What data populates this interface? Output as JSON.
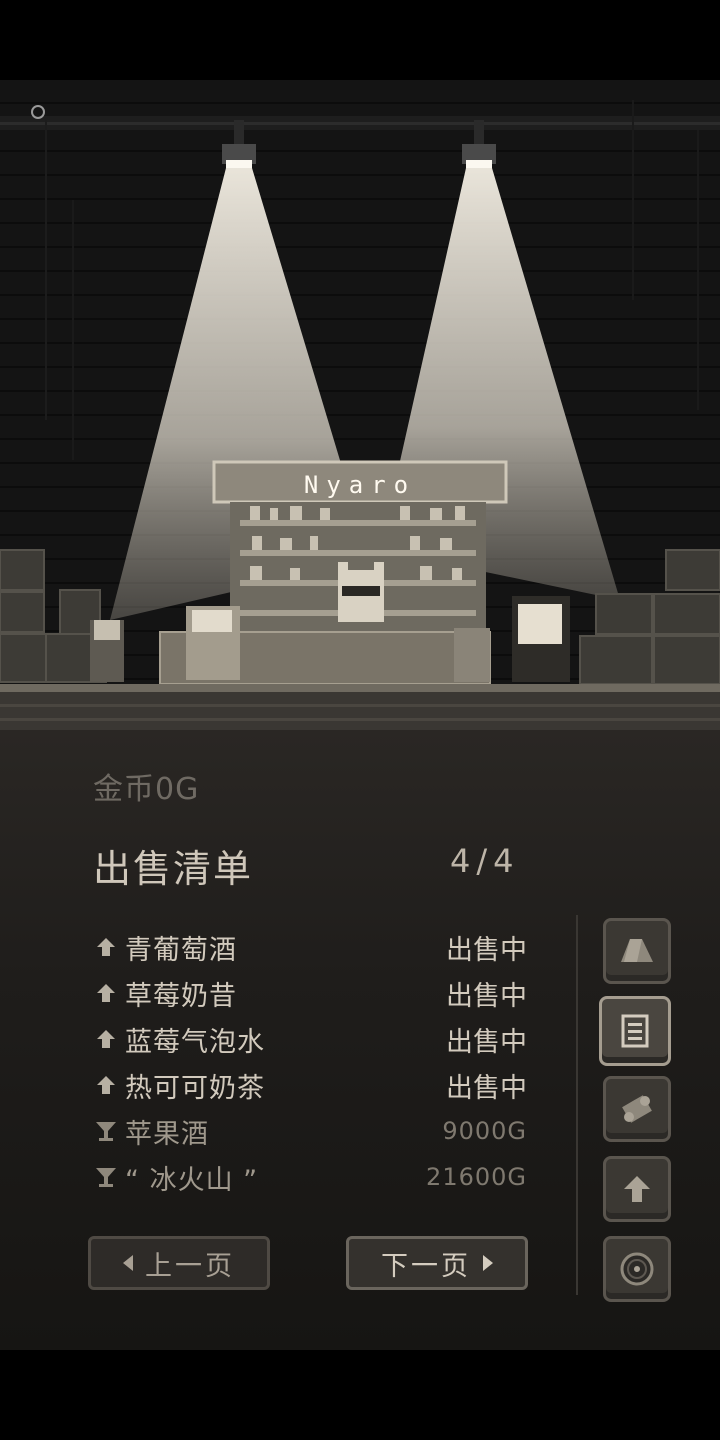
{
  "scene": {
    "shop_sign": "Nyaro"
  },
  "panel": {
    "gold_label": "金币",
    "gold_value": "0G",
    "list_title": "出售清单",
    "page": "4/4",
    "items": [
      {
        "icon": "arrow-up-icon",
        "name": "青葡萄酒",
        "status": "出售中"
      },
      {
        "icon": "arrow-up-icon",
        "name": "草莓奶昔",
        "status": "出售中"
      },
      {
        "icon": "arrow-up-icon",
        "name": "蓝莓气泡水",
        "status": "出售中"
      },
      {
        "icon": "arrow-up-icon",
        "name": "热可可奶茶",
        "status": "出售中"
      },
      {
        "icon": "cocktail-glass-icon",
        "name": "苹果酒",
        "status": "9000G"
      },
      {
        "icon": "cocktail-glass-icon",
        "name": "“ 冰火山 ”",
        "status": "21600G"
      }
    ],
    "prev_label": "上一页",
    "next_label": "下一页",
    "side_buttons": [
      "tent-icon",
      "document-icon",
      "scroll-icon",
      "arrow-up-icon",
      "record-icon"
    ],
    "active_side_button": "document-icon"
  },
  "colors": {
    "panel_bg": "#1f1d1b",
    "text_light": "#d2cabd",
    "text_muted": "#7f796f",
    "scene_light": "#e8e2d6"
  }
}
